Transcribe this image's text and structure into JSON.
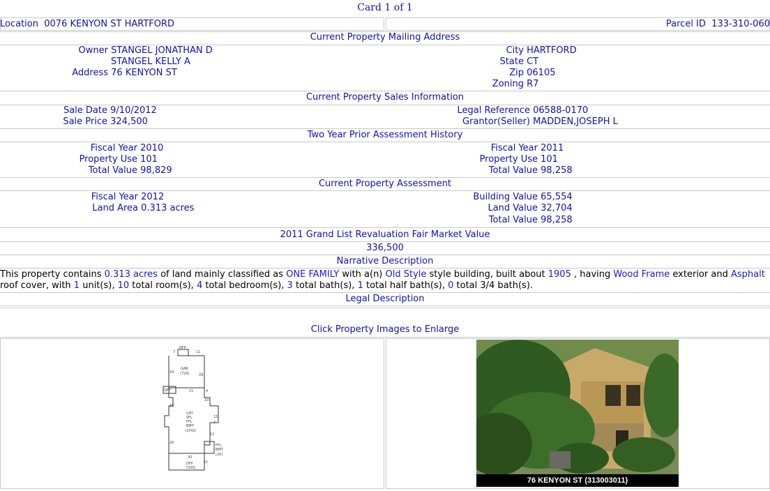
{
  "card_title": "Card 1 of 1",
  "location": {
    "label": "Location",
    "value": "0076 KENYON ST HARTFORD"
  },
  "parcel": {
    "label": "Parcel ID",
    "value": "133-310-060"
  },
  "mailing": {
    "header": "Current Property Mailing Address",
    "owner_label": "Owner",
    "owner1": "STANGEL JONATHAN D",
    "owner2": "STANGEL KELLY A",
    "address_label": "Address",
    "address": "76 KENYON ST",
    "city_label": "City",
    "city": "HARTFORD",
    "state_label": "State",
    "state": "CT",
    "zip_label": "Zip",
    "zip": "06105",
    "zoning_label": "Zoning",
    "zoning": "R7"
  },
  "sales": {
    "header": "Current Property Sales Information",
    "sale_date_label": "Sale Date",
    "sale_date": "9/10/2012",
    "sale_price_label": "Sale Price",
    "sale_price": "324,500",
    "legal_ref_label": "Legal Reference",
    "legal_ref": "06588-0170",
    "grantor_label": "Grantor(Seller)",
    "grantor": "MADDEN,JOSEPH L"
  },
  "history": {
    "header": "Two Year Prior Assessment History",
    "left": {
      "fy_label": "Fiscal Year",
      "fy": "2010",
      "use_label": "Property Use",
      "use": "101",
      "total_label": "Total Value",
      "total": "98,829"
    },
    "right": {
      "fy_label": "Fiscal Year",
      "fy": "2011",
      "use_label": "Property Use",
      "use": "101",
      "total_label": "Total Value",
      "total": "98,258"
    }
  },
  "assessment": {
    "header": "Current Property Assessment",
    "fy_label": "Fiscal Year",
    "fy": "2012",
    "land_area_label": "Land Area",
    "land_area": "0.313 acres",
    "building_label": "Building Value",
    "building": "65,554",
    "land_value_label": "Land Value",
    "land_value": "32,704",
    "total_label": "Total Value",
    "total": "98,258"
  },
  "revaluation": {
    "header": "2011 Grand List Revaluation Fair Market Value",
    "value": "336,500"
  },
  "narrative": {
    "header": "Narrative Description",
    "t1": "This property contains ",
    "acres": "0.313 acres",
    "t2": " of land mainly classified as ",
    "class": "ONE FAMILY",
    "t3": " with a(n) ",
    "style": "Old Style",
    "t4": " style building, built about ",
    "year": "1905",
    "t5": " , having ",
    "exterior": "Wood Frame",
    "t6": " exterior and ",
    "roof": "Asphalt",
    "t7": " roof cover, with ",
    "units": "1",
    "t8": " unit(s), ",
    "rooms": "10",
    "t9": " total room(s), ",
    "bedrooms": "4",
    "t10": " total bedroom(s), ",
    "baths": "3",
    "t11": " total bath(s), ",
    "half_baths": "1",
    "t12": " total half bath(s), ",
    "three_quarter": "0",
    "t13": " total 3/4 bath(s)."
  },
  "legal": {
    "header": "Legal Description"
  },
  "images": {
    "header": "Click Property Images to Enlarge",
    "photo_caption": "76 KENYON ST (313003011)",
    "sketch": {
      "labels": [
        "OFP",
        "11",
        "7",
        "GAR",
        "(729)",
        "24",
        "29",
        "21",
        "4",
        "OFP",
        "10",
        "18",
        "UAT",
        "SFL",
        "FFL",
        "BMT",
        "(1542)",
        "15",
        "7",
        "12",
        "20",
        "FFL",
        "BMT",
        "(20)",
        "30",
        "OFP",
        "(330)",
        "11"
      ]
    }
  },
  "colors": {
    "text": "#1a1acc",
    "rule": "#c8c8c8"
  }
}
